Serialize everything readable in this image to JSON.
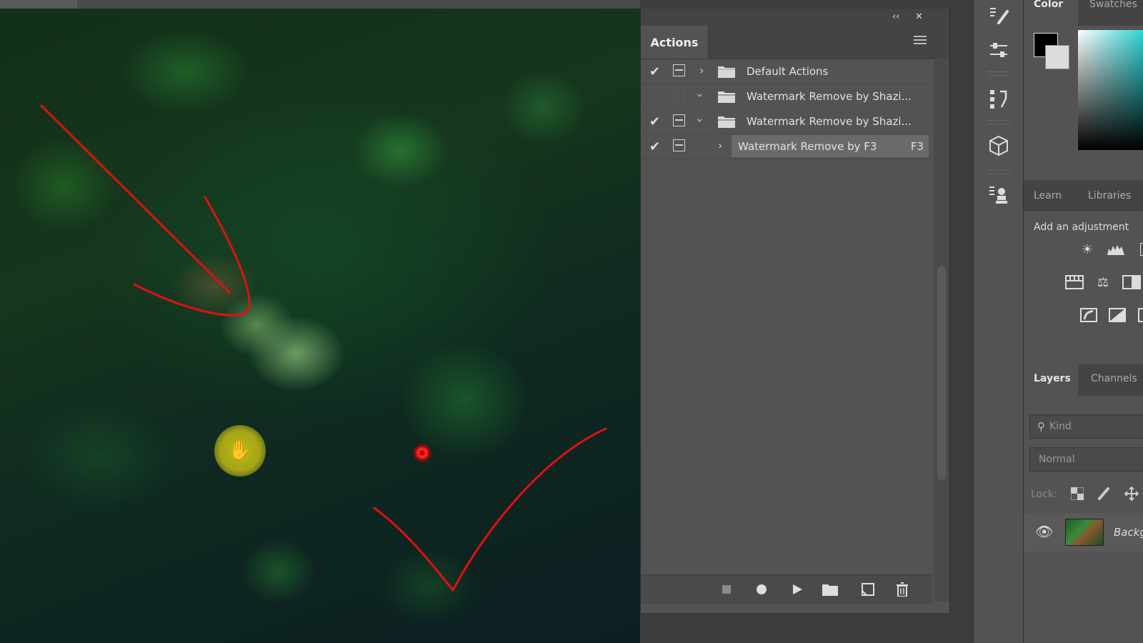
{
  "actions_panel": {
    "title": "Actions",
    "collapse_glyph": "‹‹",
    "close_glyph": "✕",
    "rows": [
      {
        "label": "Default Actions",
        "checked": true,
        "dialog": true,
        "expanded": false,
        "type": "set"
      },
      {
        "label": "Watermark Remove by Shazi...",
        "checked": false,
        "dialog": false,
        "expanded": true,
        "type": "set"
      },
      {
        "label": "Watermark Remove by Shazi...",
        "checked": true,
        "dialog": true,
        "expanded": true,
        "type": "set"
      },
      {
        "label": "Watermark Remove by F3",
        "checked": true,
        "dialog": true,
        "expanded": false,
        "type": "action",
        "shortcut": "F3",
        "selected": true
      }
    ],
    "footer_buttons": [
      "stop-icon",
      "record-icon",
      "play-icon",
      "new-set-icon",
      "new-action-icon",
      "delete-icon"
    ]
  },
  "right_panels": {
    "color_tabs": [
      "Color",
      "Swatches"
    ],
    "learn_tabs": [
      "Learn",
      "Libraries"
    ],
    "adjustments_heading": "Add an adjustment",
    "layers_tabs": [
      "Layers",
      "Channels"
    ],
    "filter_kind": "Kind",
    "blend_mode": "Normal",
    "lock_label": "Lock:",
    "layer_name": "Backg"
  },
  "colors": {
    "annotation": "#e01010",
    "cursor_highlight": "#c8c314",
    "selected_row": "#6a6a6a"
  }
}
